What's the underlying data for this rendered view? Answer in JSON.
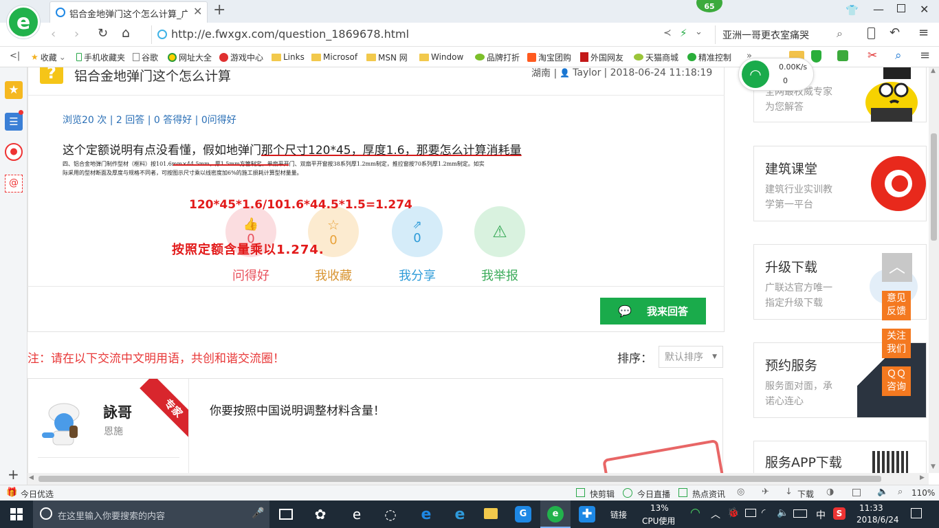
{
  "browser": {
    "tab_title": "铝合金地弹门这个怎么计算_广联",
    "badge": "65",
    "address_url": "http://e.fwxgx.com/question_1869678.html",
    "search_text": "亚洲一哥更衣室痛哭",
    "bookmarks": [
      "收藏",
      "手机收藏夹",
      "谷歌",
      "网址大全",
      "游戏中心",
      "Links",
      "Microsof",
      "MSN 网",
      "Window",
      "品牌打折",
      "淘宝团购",
      "外国网友",
      "天猫商城",
      "精准控制"
    ],
    "net_speed": "0.00K/s",
    "net_count": "0"
  },
  "question": {
    "title": "铝合金地弹门这个怎么计算",
    "location": "湖南 |",
    "author": "Taylor",
    "datetime": "| 2018-06-24 11:18:19",
    "stats": "浏览20 次 | 2 回答 | 0 答得好 | 0问得好",
    "body_prefix": "这个定额说明有点没看懂，假如地弹门",
    "body_underlined": "那个尺寸120*45，厚度1.6，那要怎么计算消耗量",
    "doc_line1": "四、铝合金地弹门制作型材（框料）按101.6mm×44.5mm，厚1.5mm方管制定，单扇平开门、双扇平开窗按38系列厚1.2mm制定，推拉窗按70系列厚1.2mm制定。如实",
    "doc_line2": "际采用的型材断面及厚度与规格不同者，可按图示尺寸乘以线密度加6%的施工损耗计算型材量量。",
    "formula": "120*45*1.6/101.6*44.5*1.5=1.274",
    "instruction": "按照定额含量乘以1.274."
  },
  "actions": [
    {
      "label": "问得好",
      "count": "0",
      "color": "#e8505b"
    },
    {
      "label": "我收藏",
      "count": "0",
      "color": "#e8a23a"
    },
    {
      "label": "我分享",
      "count": "0",
      "color": "#2d9bd8"
    },
    {
      "label": "我举报",
      "count": "",
      "color": "#3bab5a"
    }
  ],
  "answer_button": "我来回答",
  "notice": "注：请在以下交流中文明用语，共创和谐交流圈！",
  "sort": {
    "label": "排序：",
    "value": "默认排序"
  },
  "answer": {
    "user": "詠哥",
    "subtitle": "恩施",
    "ribbon": "专家",
    "text": "你要按照中国说明调整材料含量！"
  },
  "right_cards": [
    {
      "title": "",
      "line1": "全网最权威专家",
      "line2": "为您解答"
    },
    {
      "title": "建筑课堂",
      "line1": "建筑行业实训教",
      "line2": "学第一平台"
    },
    {
      "title": "升级下载",
      "line1": "广联达官方唯一",
      "line2": "指定升级下载"
    },
    {
      "title": "预约服务",
      "line1": "服务面对面，承",
      "line2": "诺心连心"
    },
    {
      "title": "服务APP下载",
      "line1": "",
      "line2": ""
    }
  ],
  "float_buttons": [
    {
      "l1": "意见",
      "l2": "反馈"
    },
    {
      "l1": "关注",
      "l2": "我们"
    },
    {
      "l1": "ＱＱ",
      "l2": "咨询"
    }
  ],
  "statusbar": {
    "left": "今日优选",
    "items": [
      "快剪辑",
      "今日直播",
      "热点资讯",
      "下载"
    ],
    "zoom": "110%"
  },
  "taskbar": {
    "search_placeholder": "在这里输入你要搜索的内容",
    "link_label": "链接",
    "cpu_value": "13%",
    "cpu_label": "CPU使用",
    "ime": "中",
    "time": "11:33",
    "date": "2018/6/24"
  },
  "colors": {
    "accent_green": "#1aab4b",
    "red_text": "#e21a1a",
    "orange": "#f47920",
    "link_blue": "#2a6fb6"
  }
}
